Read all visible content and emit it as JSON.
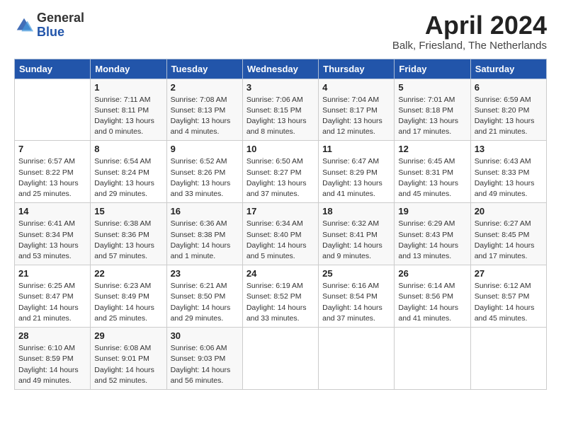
{
  "header": {
    "logo_general": "General",
    "logo_blue": "Blue",
    "month_title": "April 2024",
    "location": "Balk, Friesland, The Netherlands"
  },
  "days_of_week": [
    "Sunday",
    "Monday",
    "Tuesday",
    "Wednesday",
    "Thursday",
    "Friday",
    "Saturday"
  ],
  "weeks": [
    [
      {
        "day": "",
        "info": ""
      },
      {
        "day": "1",
        "info": "Sunrise: 7:11 AM\nSunset: 8:11 PM\nDaylight: 13 hours\nand 0 minutes."
      },
      {
        "day": "2",
        "info": "Sunrise: 7:08 AM\nSunset: 8:13 PM\nDaylight: 13 hours\nand 4 minutes."
      },
      {
        "day": "3",
        "info": "Sunrise: 7:06 AM\nSunset: 8:15 PM\nDaylight: 13 hours\nand 8 minutes."
      },
      {
        "day": "4",
        "info": "Sunrise: 7:04 AM\nSunset: 8:17 PM\nDaylight: 13 hours\nand 12 minutes."
      },
      {
        "day": "5",
        "info": "Sunrise: 7:01 AM\nSunset: 8:18 PM\nDaylight: 13 hours\nand 17 minutes."
      },
      {
        "day": "6",
        "info": "Sunrise: 6:59 AM\nSunset: 8:20 PM\nDaylight: 13 hours\nand 21 minutes."
      }
    ],
    [
      {
        "day": "7",
        "info": "Sunrise: 6:57 AM\nSunset: 8:22 PM\nDaylight: 13 hours\nand 25 minutes."
      },
      {
        "day": "8",
        "info": "Sunrise: 6:54 AM\nSunset: 8:24 PM\nDaylight: 13 hours\nand 29 minutes."
      },
      {
        "day": "9",
        "info": "Sunrise: 6:52 AM\nSunset: 8:26 PM\nDaylight: 13 hours\nand 33 minutes."
      },
      {
        "day": "10",
        "info": "Sunrise: 6:50 AM\nSunset: 8:27 PM\nDaylight: 13 hours\nand 37 minutes."
      },
      {
        "day": "11",
        "info": "Sunrise: 6:47 AM\nSunset: 8:29 PM\nDaylight: 13 hours\nand 41 minutes."
      },
      {
        "day": "12",
        "info": "Sunrise: 6:45 AM\nSunset: 8:31 PM\nDaylight: 13 hours\nand 45 minutes."
      },
      {
        "day": "13",
        "info": "Sunrise: 6:43 AM\nSunset: 8:33 PM\nDaylight: 13 hours\nand 49 minutes."
      }
    ],
    [
      {
        "day": "14",
        "info": "Sunrise: 6:41 AM\nSunset: 8:34 PM\nDaylight: 13 hours\nand 53 minutes."
      },
      {
        "day": "15",
        "info": "Sunrise: 6:38 AM\nSunset: 8:36 PM\nDaylight: 13 hours\nand 57 minutes."
      },
      {
        "day": "16",
        "info": "Sunrise: 6:36 AM\nSunset: 8:38 PM\nDaylight: 14 hours\nand 1 minute."
      },
      {
        "day": "17",
        "info": "Sunrise: 6:34 AM\nSunset: 8:40 PM\nDaylight: 14 hours\nand 5 minutes."
      },
      {
        "day": "18",
        "info": "Sunrise: 6:32 AM\nSunset: 8:41 PM\nDaylight: 14 hours\nand 9 minutes."
      },
      {
        "day": "19",
        "info": "Sunrise: 6:29 AM\nSunset: 8:43 PM\nDaylight: 14 hours\nand 13 minutes."
      },
      {
        "day": "20",
        "info": "Sunrise: 6:27 AM\nSunset: 8:45 PM\nDaylight: 14 hours\nand 17 minutes."
      }
    ],
    [
      {
        "day": "21",
        "info": "Sunrise: 6:25 AM\nSunset: 8:47 PM\nDaylight: 14 hours\nand 21 minutes."
      },
      {
        "day": "22",
        "info": "Sunrise: 6:23 AM\nSunset: 8:49 PM\nDaylight: 14 hours\nand 25 minutes."
      },
      {
        "day": "23",
        "info": "Sunrise: 6:21 AM\nSunset: 8:50 PM\nDaylight: 14 hours\nand 29 minutes."
      },
      {
        "day": "24",
        "info": "Sunrise: 6:19 AM\nSunset: 8:52 PM\nDaylight: 14 hours\nand 33 minutes."
      },
      {
        "day": "25",
        "info": "Sunrise: 6:16 AM\nSunset: 8:54 PM\nDaylight: 14 hours\nand 37 minutes."
      },
      {
        "day": "26",
        "info": "Sunrise: 6:14 AM\nSunset: 8:56 PM\nDaylight: 14 hours\nand 41 minutes."
      },
      {
        "day": "27",
        "info": "Sunrise: 6:12 AM\nSunset: 8:57 PM\nDaylight: 14 hours\nand 45 minutes."
      }
    ],
    [
      {
        "day": "28",
        "info": "Sunrise: 6:10 AM\nSunset: 8:59 PM\nDaylight: 14 hours\nand 49 minutes."
      },
      {
        "day": "29",
        "info": "Sunrise: 6:08 AM\nSunset: 9:01 PM\nDaylight: 14 hours\nand 52 minutes."
      },
      {
        "day": "30",
        "info": "Sunrise: 6:06 AM\nSunset: 9:03 PM\nDaylight: 14 hours\nand 56 minutes."
      },
      {
        "day": "",
        "info": ""
      },
      {
        "day": "",
        "info": ""
      },
      {
        "day": "",
        "info": ""
      },
      {
        "day": "",
        "info": ""
      }
    ]
  ]
}
